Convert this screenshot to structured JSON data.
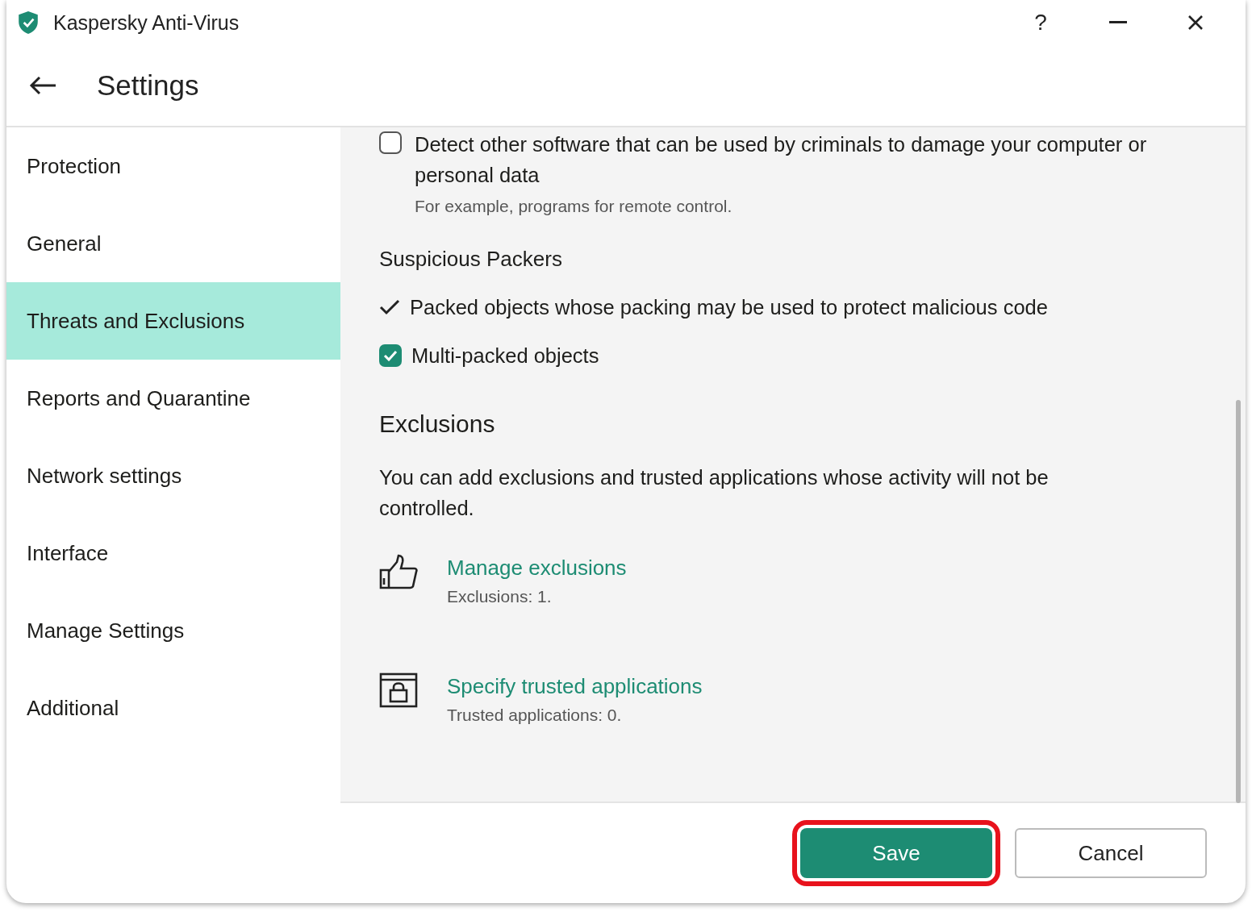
{
  "window": {
    "title": "Kaspersky Anti-Virus",
    "help": "?"
  },
  "header": {
    "title": "Settings"
  },
  "sidebar": {
    "items": [
      {
        "label": "Protection",
        "selected": false
      },
      {
        "label": "General",
        "selected": false
      },
      {
        "label": "Threats and Exclusions",
        "selected": true
      },
      {
        "label": "Reports and Quarantine",
        "selected": false
      },
      {
        "label": "Network settings",
        "selected": false
      },
      {
        "label": "Interface",
        "selected": false
      },
      {
        "label": "Manage Settings",
        "selected": false
      },
      {
        "label": "Additional",
        "selected": false
      }
    ]
  },
  "top_options": [
    {
      "kind": "checkbox",
      "label": "Detect other software that can be used by criminals to damage your computer or personal data",
      "checked": false,
      "hint": "For example, programs for remote control."
    }
  ],
  "packers": {
    "title": "Suspicious Packers",
    "options": [
      {
        "kind": "tick",
        "label": "Packed objects whose packing may be used to protect malicious code",
        "checked": true
      },
      {
        "kind": "checkbox",
        "label": "Multi-packed objects",
        "checked": true
      }
    ]
  },
  "exclusions": {
    "title": "Exclusions",
    "description": "You can add exclusions and trusted applications whose activity will not be controlled.",
    "links": [
      {
        "kind": "thumb",
        "label": "Manage exclusions",
        "detail": "Exclusions: 1."
      },
      {
        "kind": "lock",
        "label": "Specify trusted applications",
        "detail": "Trusted applications: 0."
      }
    ]
  },
  "footer": {
    "buttons": [
      {
        "kind": "primary",
        "label": "Save",
        "highlighted": true
      },
      {
        "kind": "secondary",
        "label": "Cancel",
        "highlighted": false
      }
    ]
  }
}
